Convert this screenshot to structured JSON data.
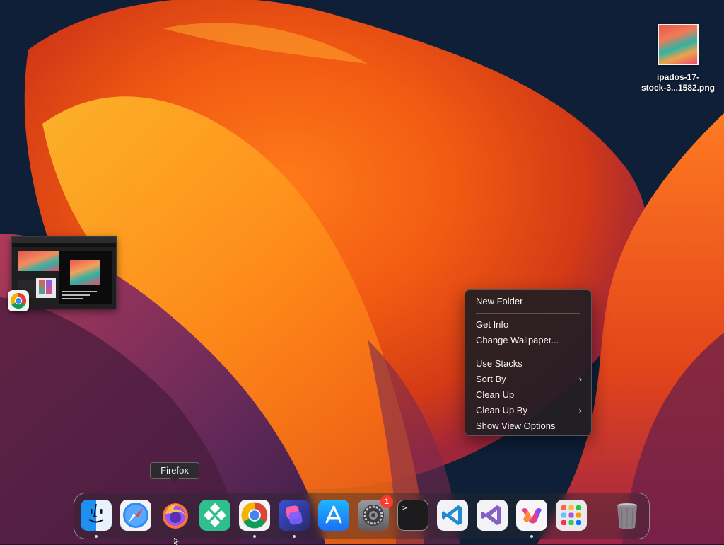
{
  "desktop": {
    "file": {
      "name": "ipados-17-\nstock-3...1582.png"
    }
  },
  "window_preview": {
    "app_icon": "chrome-icon"
  },
  "context_menu": {
    "items": [
      {
        "label": "New Folder"
      },
      {
        "label": "Get Info"
      },
      {
        "label": "Change Wallpaper..."
      },
      {
        "label": "Use Stacks"
      },
      {
        "label": "Sort By",
        "submenu": true
      },
      {
        "label": "Clean Up"
      },
      {
        "label": "Clean Up By",
        "submenu": true
      },
      {
        "label": "Show View Options"
      }
    ],
    "chevron": "›"
  },
  "tooltip": {
    "label": "Firefox"
  },
  "dock": {
    "apps": [
      {
        "icon": "finder-icon",
        "running": true
      },
      {
        "icon": "safari-icon",
        "running": false
      },
      {
        "icon": "firefox-icon",
        "running": false
      },
      {
        "icon": "tableplus-icon",
        "running": false
      },
      {
        "icon": "chrome-icon",
        "running": true
      },
      {
        "icon": "shortcuts-icon",
        "running": true
      },
      {
        "icon": "app-store-icon",
        "running": false
      },
      {
        "icon": "system-settings-icon",
        "running": false,
        "badge": "1"
      },
      {
        "icon": "terminal-icon",
        "running": false
      },
      {
        "icon": "vscode-icon",
        "running": false
      },
      {
        "icon": "visual-studio-icon",
        "running": false
      },
      {
        "icon": "office-icon",
        "running": true
      },
      {
        "icon": "launchpad-icon",
        "running": false
      },
      {
        "icon": "trash-icon",
        "running": false
      }
    ],
    "terminal_prompt": ">_"
  }
}
